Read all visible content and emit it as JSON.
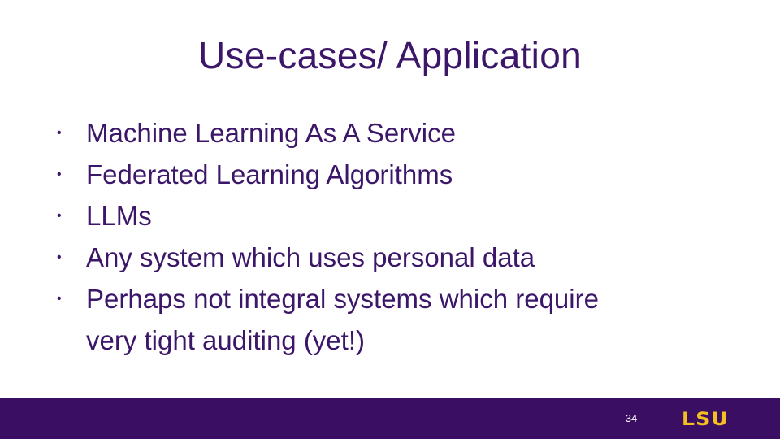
{
  "slide": {
    "title": "Use-cases/ Application",
    "bullets": [
      {
        "text": "Machine Learning As A Service"
      },
      {
        "text": "Federated Learning Algorithms"
      },
      {
        "text": "LLMs"
      },
      {
        "text": "Any system which uses personal data"
      },
      {
        "text": "Perhaps not integral systems which require"
      },
      {
        "text": "very tight auditing (yet!)",
        "continuation": true
      }
    ],
    "bullet_symbol": "•"
  },
  "footer": {
    "page_number": "34",
    "logo_text": "LSU",
    "bar_color": "#3a0f63",
    "logo_color": "#f5bf1f"
  },
  "colors": {
    "text": "#3c1769",
    "background": "#ffffff"
  }
}
